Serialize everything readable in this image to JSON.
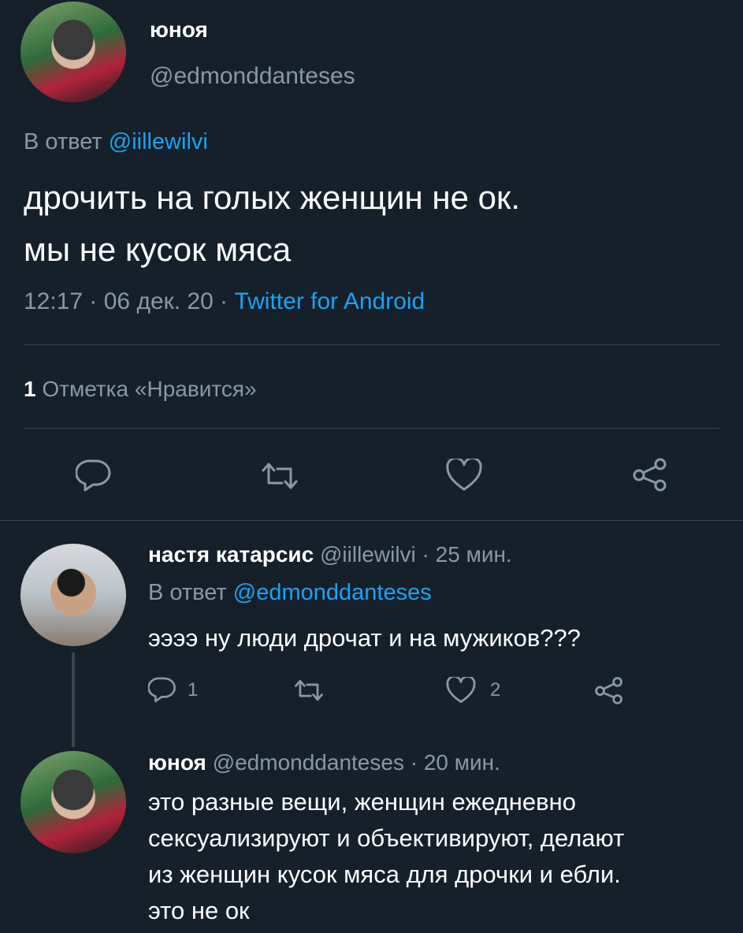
{
  "main_tweet": {
    "author_name": "юноя",
    "author_handle": "@edmonddanteses",
    "reply_prefix": "В ответ",
    "reply_to": "@iillewilvi",
    "text_line1": "дрочить на голых женщин не ок.",
    "text_line2": "мы не кусок мяса",
    "time": "12:17 · 06 дек. 20 ·",
    "source": "Twitter for Android",
    "likes_count": "1",
    "likes_label": "Отметка «Нравится»"
  },
  "reply1": {
    "author_name": "настя катарсис",
    "meta": "@iillewilvi · 25 мин.",
    "reply_prefix": "В ответ",
    "reply_to": "@edmonddanteses",
    "text": "ээээ ну люди дрочат и на мужиков???",
    "reply_count": "1",
    "like_count": "2"
  },
  "reply2": {
    "author_name": "юноя",
    "meta": "@edmonddanteses · 20 мин.",
    "line1": "это разные вещи, женщин ежедневно",
    "line2": "сексуализируют и объективируют, делают",
    "line3": "из женщин кусок мяса для дрочки и ебли.",
    "line4": "это не ок"
  },
  "icons": {
    "reply": "reply-icon",
    "retweet": "retweet-icon",
    "like": "heart-icon",
    "share": "share-icon"
  },
  "colors": {
    "background": "#15202b",
    "link": "#1da1f2",
    "muted": "#8899a6",
    "divider": "#38444d"
  }
}
